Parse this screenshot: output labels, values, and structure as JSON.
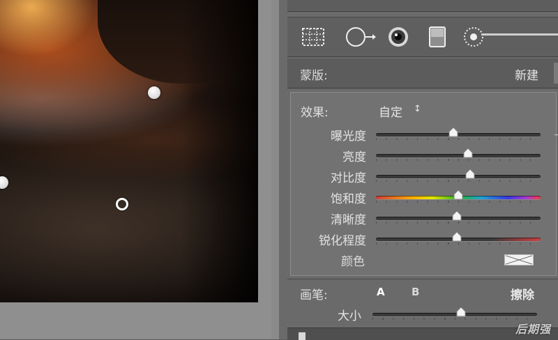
{
  "mask": {
    "label": "蒙版:",
    "new_label": "新建"
  },
  "effects": {
    "label": "效果:",
    "preset_value": "自定",
    "preset_arrow": "↕",
    "sliders": [
      {
        "name": "曝光度",
        "value": 0.47,
        "style": "plain"
      },
      {
        "name": "亮度",
        "value": 0.56,
        "style": "plain"
      },
      {
        "name": "对比度",
        "value": 0.57,
        "style": "plain"
      },
      {
        "name": "饱和度",
        "value": 0.5,
        "style": "rainbow"
      },
      {
        "name": "清晰度",
        "value": 0.49,
        "style": "plain"
      },
      {
        "name": "锐化程度",
        "value": 0.49,
        "style": "redtail"
      }
    ],
    "color_label": "颜色"
  },
  "brush": {
    "label": "画笔:",
    "option_a": "A",
    "option_b": "B",
    "erase_label": "擦除",
    "size_label": "大小",
    "size_value": 0.54
  },
  "toolbar": {
    "icons": [
      "crop-overlay-icon",
      "spot-removal-icon",
      "red-eye-icon",
      "graduated-filter-icon",
      "adjustment-brush-icon"
    ]
  },
  "watermark": "后期强",
  "colors": {
    "panel_bg": "#6b6b6b",
    "text": "#e3e3e3",
    "accent_white": "#ffffff"
  }
}
